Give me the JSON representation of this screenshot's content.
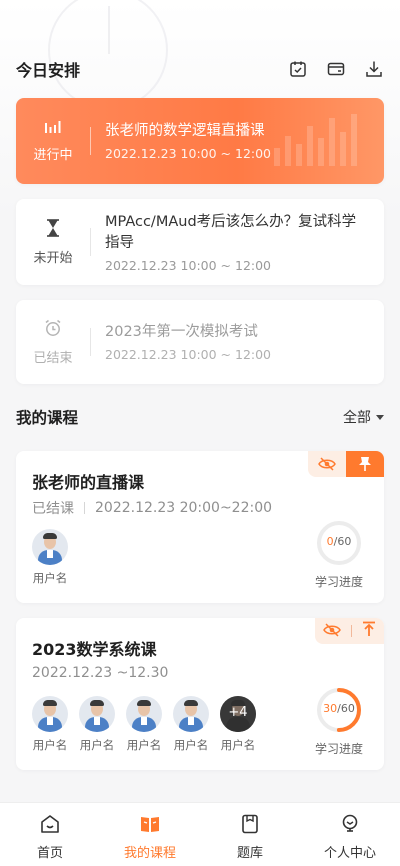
{
  "header": {
    "title": "今日安排",
    "icons": [
      "calendar-check-icon",
      "wallet-icon",
      "download-icon"
    ]
  },
  "schedule": [
    {
      "status": "进行中",
      "title": "张老师的数学逻辑直播课",
      "time": "2022.12.23  10:00 ~ 12:00",
      "state": "active"
    },
    {
      "status": "未开始",
      "title": "MPAcc/MAud考后该怎么办？复试科学指导",
      "time": "2022.12.23  10:00 ~ 12:00",
      "state": "pending"
    },
    {
      "status": "已结束",
      "title": "2023年第一次模拟考试",
      "time": "2022.12.23  10:00 ~ 12:00",
      "state": "ended"
    }
  ],
  "courses_section": {
    "title": "我的课程",
    "filter": "全部"
  },
  "courses": [
    {
      "title": "张老师的直播课",
      "status": "已结课",
      "time": "2022.12.23  20:00~22:00",
      "users": [
        "用户名"
      ],
      "progress_current": "0",
      "progress_total": "/60",
      "progress_fraction": 0,
      "progress_label": "学习进度"
    },
    {
      "title": "2023数学系统课",
      "time": "2022.12.23 ~12.30",
      "users": [
        "用户名",
        "用户名",
        "用户名",
        "用户名",
        "用户名"
      ],
      "more_count": "+4",
      "progress_current": "30",
      "progress_total": "/60",
      "progress_fraction": 0.5,
      "progress_label": "学习进度"
    }
  ],
  "bottom_nav": [
    {
      "label": "首页",
      "icon": "home-icon"
    },
    {
      "label": "我的课程",
      "icon": "course-book-icon",
      "active": true
    },
    {
      "label": "题库",
      "icon": "question-bank-icon"
    },
    {
      "label": "个人中心",
      "icon": "profile-icon"
    }
  ],
  "colors": {
    "accent": "#ff7a2e",
    "active_card": "#ff8a5c"
  }
}
